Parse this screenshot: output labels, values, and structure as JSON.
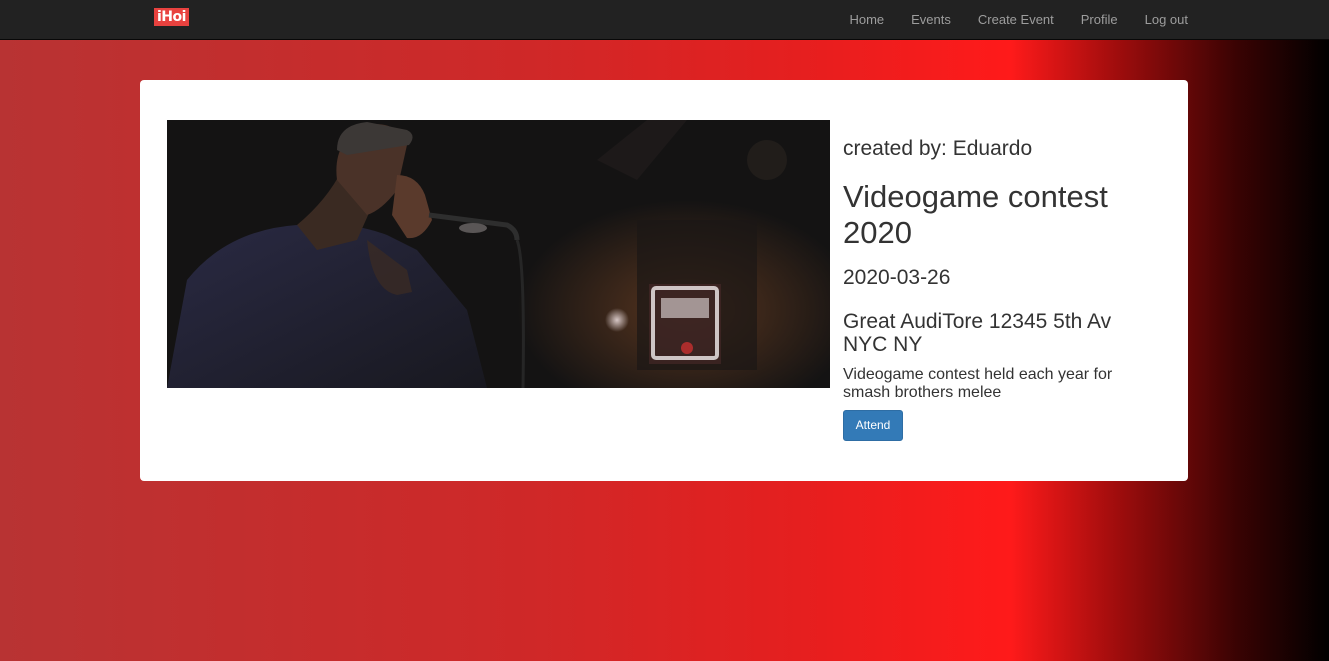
{
  "header": {
    "brand": "iHoi",
    "nav": {
      "home": "Home",
      "events": "Events",
      "create_event": "Create Event",
      "profile": "Profile",
      "logout": "Log out"
    }
  },
  "event": {
    "created_by": "created by: Eduardo",
    "title": "Videogame contest 2020",
    "date": "2020-03-26",
    "location": "Great AudiTore 12345 5th Av NYC NY",
    "description": "Videogame contest held each year for smash brothers melee",
    "attend_label": "Attend"
  },
  "colors": {
    "navbar": "#222222",
    "brand": "#e8423f",
    "button": "#337ab7",
    "background_gradient": [
      "#b83333",
      "#ff1a1a",
      "#000000"
    ]
  }
}
